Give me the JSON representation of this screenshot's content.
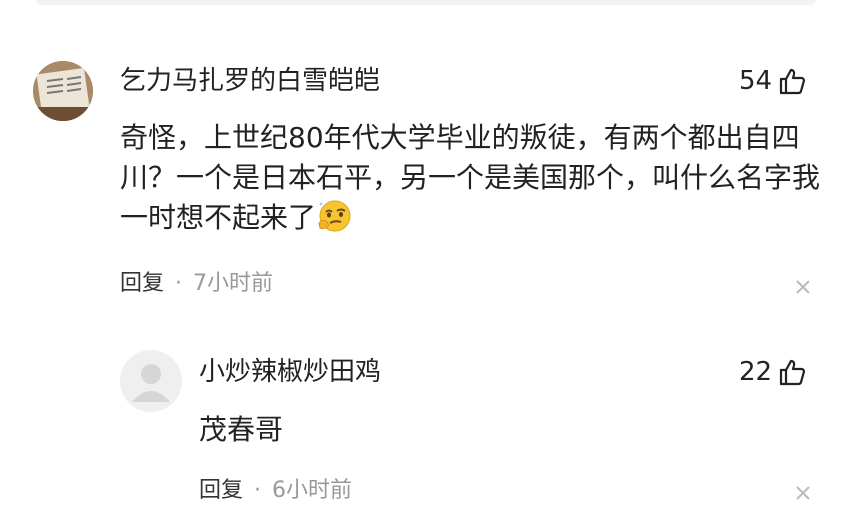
{
  "comment": {
    "author": "乞力马扎罗的白雪皑皑",
    "likes": "54",
    "text": "奇怪，上世纪80年代大学毕业的叛徒，有两个都出自四川？一个是日本石平，另一个是美国那个，叫什么名字我一时想不起来了",
    "emoji": "thinking-face-emoji",
    "reply_label": "回复",
    "separator": "·",
    "time": "7小时前"
  },
  "reply": {
    "author": "小炒辣椒炒田鸡",
    "likes": "22",
    "text": "茂春哥",
    "reply_label": "回复",
    "separator": "·",
    "time": "6小时前"
  },
  "colors": {
    "text": "#222222",
    "meta": "#999999",
    "icon": "#222222",
    "close": "#bbbbbb"
  }
}
